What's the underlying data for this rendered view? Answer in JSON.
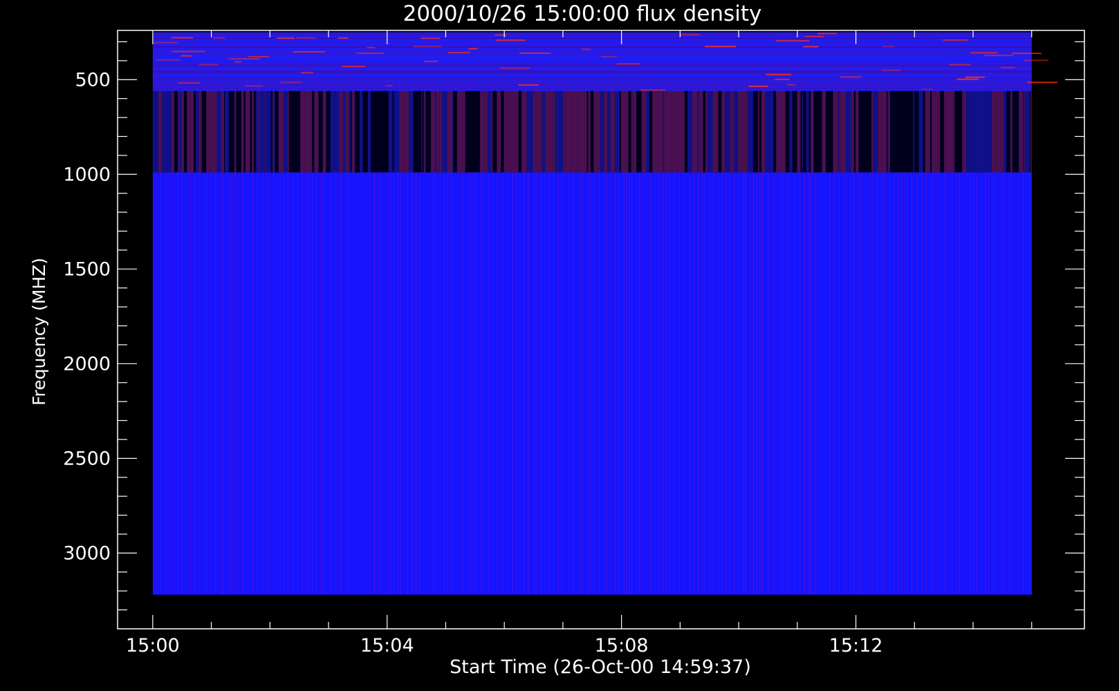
{
  "chart_data": {
    "type": "heatmap",
    "title": "2000/10/26 15:00:00 flux density",
    "xlabel": "Start Time (26-Oct-00 14:59:37)",
    "ylabel": "Frequency (MHZ)",
    "x_ticks": [
      "15:00",
      "15:04",
      "15:08",
      "15:12"
    ],
    "y_ticks": [
      500,
      1000,
      1500,
      2000,
      2500,
      3000
    ],
    "y_axis": "frequency increasing downward",
    "xlim_minutes_after_15_00": [
      -0.6,
      15.9
    ],
    "ylim": [
      240,
      3400
    ],
    "data_time_range_minutes": [
      0,
      15.0
    ],
    "data_freq_range": [
      250,
      3220
    ],
    "bands": [
      {
        "name": "low",
        "freq_range": [
          250,
          560
        ],
        "appearance": "blue with red streaks"
      },
      {
        "name": "mid",
        "freq_range": [
          560,
          990
        ],
        "appearance": "dark columns alternating black / purple"
      },
      {
        "name": "high",
        "freq_range": [
          990,
          3220
        ],
        "appearance": "bright blue with thin vertical stripes"
      }
    ],
    "colors": {
      "background": "#000000",
      "high_band": "#1414ff",
      "low_band": "#2a1ae0",
      "mid_dark": "#00001e",
      "mid_purple": "#4a1052",
      "stripe_red": "#6a14c8",
      "streak": "#ff3010",
      "axis": "#ffffff"
    }
  }
}
